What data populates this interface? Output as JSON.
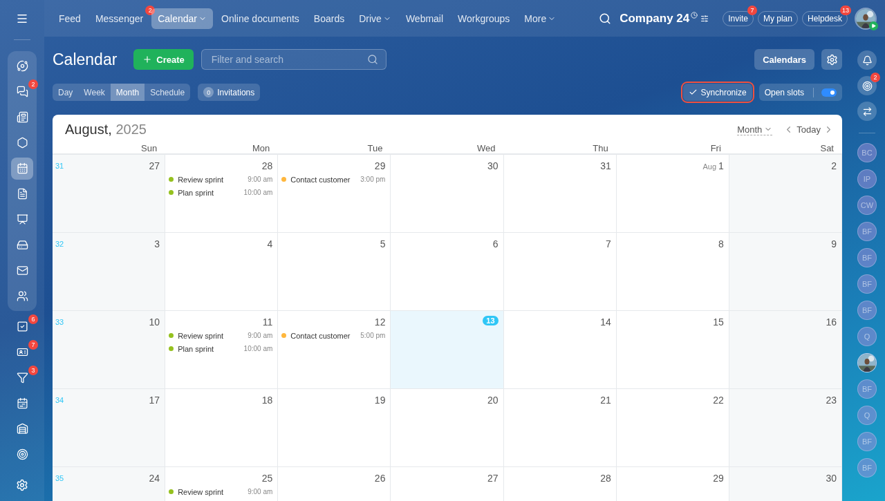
{
  "top_nav": [
    {
      "label": "Feed",
      "selected": false,
      "dropdown": false
    },
    {
      "label": "Messenger",
      "selected": false,
      "dropdown": false,
      "badge": "2"
    },
    {
      "label": "Calendar",
      "selected": true,
      "dropdown": true
    },
    {
      "label": "Online documents",
      "selected": false,
      "dropdown": false
    },
    {
      "label": "Boards",
      "selected": false,
      "dropdown": false
    },
    {
      "label": "Drive",
      "selected": false,
      "dropdown": true
    },
    {
      "label": "Webmail",
      "selected": false,
      "dropdown": false
    },
    {
      "label": "Workgroups",
      "selected": false,
      "dropdown": false
    },
    {
      "label": "More",
      "selected": false,
      "dropdown": true
    }
  ],
  "company": "Company 24",
  "header_buttons": [
    {
      "label": "Invite",
      "badge": "7"
    },
    {
      "label": "My plan"
    },
    {
      "label": "Helpdesk",
      "badge": "13"
    }
  ],
  "left_rail": {
    "group": [
      {
        "kind": "feed",
        "selected": false
      },
      {
        "kind": "chat",
        "selected": false,
        "badge": "2"
      },
      {
        "kind": "news",
        "selected": false
      },
      {
        "kind": "hexagon",
        "selected": false
      },
      {
        "kind": "calendar",
        "selected": true
      },
      {
        "kind": "document",
        "selected": false
      },
      {
        "kind": "board",
        "selected": false
      },
      {
        "kind": "drive",
        "selected": false
      },
      {
        "kind": "mail",
        "selected": false
      },
      {
        "kind": "users",
        "selected": false
      }
    ],
    "more": [
      {
        "kind": "tasks",
        "selected": false,
        "badge": "6"
      },
      {
        "kind": "contact",
        "selected": false,
        "badge": "7"
      },
      {
        "kind": "funnel",
        "selected": false,
        "badge": "3"
      },
      {
        "kind": "schedule",
        "selected": false
      },
      {
        "kind": "warehouse",
        "selected": false
      },
      {
        "kind": "target",
        "selected": false
      }
    ]
  },
  "page_title": "Calendar",
  "create_button": "Create",
  "search": {
    "placeholder": "Filter and search"
  },
  "calendars_button": "Calendars",
  "view_tabs": [
    {
      "label": "Day",
      "selected": false
    },
    {
      "label": "Week",
      "selected": false
    },
    {
      "label": "Month",
      "selected": true
    },
    {
      "label": "Schedule",
      "selected": false
    }
  ],
  "invitations": {
    "count": "0",
    "label": "Invitations"
  },
  "synchronize": {
    "label": "Synchronize",
    "highlighted": true
  },
  "open_slots": {
    "label": "Open slots",
    "on": true
  },
  "calendar": {
    "month": "August,",
    "year": "2025",
    "view": "Month",
    "today_button": "Today",
    "weekdays": [
      "Sun",
      "Mon",
      "Tue",
      "Wed",
      "Thu",
      "Fri",
      "Sat"
    ],
    "weeks": [
      {
        "number": "31",
        "days": [
          {
            "day": "27",
            "today": false
          },
          {
            "day": "28",
            "today": false,
            "events": [
              {
                "title": "Review sprint",
                "time": "9:00 am",
                "color": "#95c11f"
              },
              {
                "title": "Plan sprint",
                "time": "10:00 am",
                "color": "#95c11f"
              }
            ]
          },
          {
            "day": "29",
            "today": false,
            "events": [
              {
                "title": "Contact customer",
                "time": "3:00 pm",
                "color": "#ffb73d"
              }
            ]
          },
          {
            "day": "30",
            "today": false
          },
          {
            "day": "31",
            "today": false
          },
          {
            "month": "Aug",
            "day": "1",
            "today": false
          },
          {
            "day": "2",
            "today": false
          }
        ]
      },
      {
        "number": "32",
        "days": [
          {
            "day": "3",
            "today": false
          },
          {
            "day": "4",
            "today": false
          },
          {
            "day": "5",
            "today": false
          },
          {
            "day": "6",
            "today": false
          },
          {
            "day": "7",
            "today": false
          },
          {
            "day": "8",
            "today": false
          },
          {
            "day": "9",
            "today": false
          }
        ]
      },
      {
        "number": "33",
        "days": [
          {
            "day": "10",
            "today": false
          },
          {
            "day": "11",
            "today": false,
            "events": [
              {
                "title": "Review sprint",
                "time": "9:00 am",
                "color": "#95c11f"
              },
              {
                "title": "Plan sprint",
                "time": "10:00 am",
                "color": "#95c11f"
              }
            ]
          },
          {
            "day": "12",
            "today": false,
            "events": [
              {
                "title": "Contact customer",
                "time": "5:00 pm",
                "color": "#ffb73d"
              }
            ]
          },
          {
            "day": "13",
            "today": true
          },
          {
            "day": "14",
            "today": false
          },
          {
            "day": "15",
            "today": false
          },
          {
            "day": "16",
            "today": false
          }
        ]
      },
      {
        "number": "34",
        "days": [
          {
            "day": "17",
            "today": false
          },
          {
            "day": "18",
            "today": false
          },
          {
            "day": "19",
            "today": false
          },
          {
            "day": "20",
            "today": false
          },
          {
            "day": "21",
            "today": false
          },
          {
            "day": "22",
            "today": false
          },
          {
            "day": "23",
            "today": false
          }
        ]
      },
      {
        "number": "35",
        "days": [
          {
            "day": "24",
            "today": false
          },
          {
            "day": "25",
            "today": false,
            "events": [
              {
                "title": "Review sprint",
                "time": "9:00 am",
                "color": "#95c11f"
              }
            ]
          },
          {
            "day": "26",
            "today": false
          },
          {
            "day": "27",
            "today": false
          },
          {
            "day": "28",
            "today": false
          },
          {
            "day": "29",
            "today": false
          },
          {
            "day": "30",
            "today": false
          }
        ]
      }
    ]
  },
  "right_rail": {
    "tools": [
      {
        "kind": "bell"
      },
      {
        "kind": "target",
        "badge": "2"
      },
      {
        "kind": "chat"
      }
    ],
    "contacts": [
      {
        "initials": "BC"
      },
      {
        "initials": "IP"
      },
      {
        "initials": "CW"
      },
      {
        "initials": "BF"
      },
      {
        "initials": "BF"
      },
      {
        "initials": "BF"
      },
      {
        "initials": "BF"
      },
      {
        "initials": "Q"
      },
      {
        "kind": "picture"
      },
      {
        "initials": "BF"
      },
      {
        "initials": "Q"
      },
      {
        "initials": "BF"
      },
      {
        "initials": "BF"
      }
    ]
  }
}
